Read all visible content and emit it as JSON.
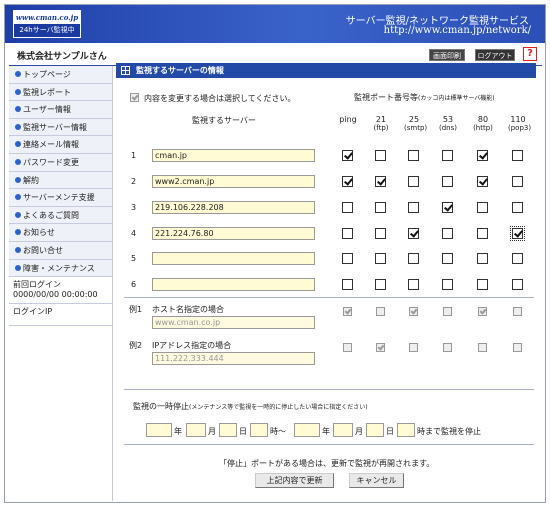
{
  "header": {
    "logo_url": "www.cman.co.jp",
    "logo_sub": "24hサーバ監視中",
    "title": "サーバー監視/ネットワーク監視サービス",
    "url": "http://www.cman.jp/network/"
  },
  "company": "株式会社サンプルさん",
  "top_buttons": {
    "print": "画面印刷",
    "logout": "ログアウト",
    "help": "?"
  },
  "sidebar": {
    "items": [
      "トップページ",
      "監視レポート",
      "ユーザー情報",
      "監視サーバー情報",
      "連絡メール情報",
      "パスワード変更",
      "解約",
      "サーバーメンテ支援",
      "よくあるご質問",
      "お知らせ",
      "お問い合せ",
      "障害・メンテナンス"
    ],
    "last_login_label": "前回ログイン",
    "last_login_value": "0000/00/00 00:00:00",
    "login_ip_label": "ログインIP"
  },
  "section_title": "監視するサーバーの情報",
  "change_note": "内容を変更する場合は選択してください。",
  "ports_heading": "監視ポート番号等",
  "ports_heading_note": "(カッコ内は標準サーバ機能)",
  "server_col_heading": "監視するサーバー",
  "port_columns": [
    {
      "top": "ping",
      "bottom": ""
    },
    {
      "top": "21",
      "bottom": "(ftp)"
    },
    {
      "top": "25",
      "bottom": "(smtp)"
    },
    {
      "top": "53",
      "bottom": "(dns)"
    },
    {
      "top": "80",
      "bottom": "(http)"
    },
    {
      "top": "110",
      "bottom": "(pop3)"
    }
  ],
  "rows": [
    {
      "no": "1",
      "server": "cman.jp",
      "checks": [
        true,
        false,
        false,
        false,
        true,
        false
      ]
    },
    {
      "no": "2",
      "server": "www2.cman.jp",
      "checks": [
        true,
        true,
        false,
        false,
        true,
        false
      ]
    },
    {
      "no": "3",
      "server": "219.106.228.208",
      "checks": [
        false,
        false,
        false,
        true,
        false,
        false
      ]
    },
    {
      "no": "4",
      "server": "221.224.76.80",
      "checks": [
        false,
        false,
        true,
        false,
        false,
        true
      ]
    },
    {
      "no": "5",
      "server": "",
      "checks": [
        false,
        false,
        false,
        false,
        false,
        false
      ]
    },
    {
      "no": "6",
      "server": "",
      "checks": [
        false,
        false,
        false,
        false,
        false,
        false
      ]
    }
  ],
  "examples": [
    {
      "no": "例1",
      "label": "ホスト名指定の場合",
      "value": "www.cman.co.jp",
      "checks": [
        true,
        false,
        true,
        false,
        true,
        false
      ]
    },
    {
      "no": "例2",
      "label": "IPアドレス指定の場合",
      "value": "111.222.333.444",
      "checks": [
        false,
        true,
        false,
        false,
        false,
        false
      ]
    }
  ],
  "pause": {
    "title": "監視の一時停止",
    "title_note": "(メンテナンス等で監視を一時的に停止したい場合に指定ください)",
    "year": "年",
    "month": "月",
    "day": "日",
    "hour_from": "時〜",
    "until": "時まで監視を停止"
  },
  "restart_note": "「停止」ポートがある場合は、更新で監視が再開されます。",
  "buttons": {
    "update": "上記内容で更新",
    "cancel": "キャンセル"
  }
}
